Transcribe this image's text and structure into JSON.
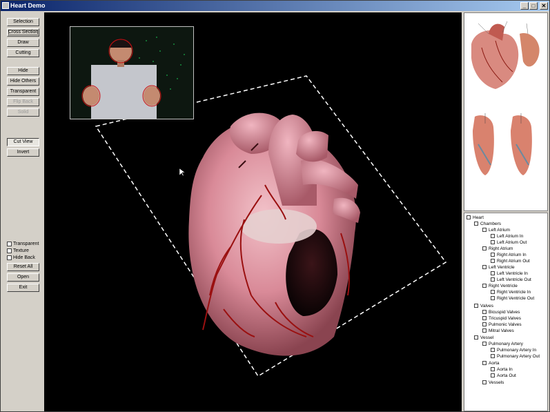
{
  "window": {
    "title": "Heart Demo"
  },
  "title_buttons": {
    "minimize": "_",
    "maximize": "□",
    "close": "✕"
  },
  "left_buttons": [
    "Selection",
    "Cross Section",
    "Draw",
    "Cutting",
    "Hide",
    "Hide Others",
    "Transparent",
    "Flip Back",
    "Solid"
  ],
  "view_buttons": [
    "Cut View",
    "Invert"
  ],
  "checkboxes": [
    "Transparent",
    "Texture",
    "Hide Back"
  ],
  "bottom_buttons": [
    "Reset All",
    "Open",
    "Exit"
  ],
  "tree": [
    "Heart",
    "Chambers",
    "Left Atrium",
    "Left Atrium In",
    "Left Atrium Out",
    "Right Atrium",
    "Right Atrium In",
    "Right Atrium Out",
    "Left Ventricle",
    "Left Ventricle In",
    "Left Ventricle Out",
    "Right Ventricle",
    "Right Ventricle In",
    "Right Ventricle Out",
    "Valves",
    "Bicuspid Valves",
    "Tricuspid Valves",
    "Pulmonic Valves",
    "Mitral Valves",
    "Vessel",
    "Pulmonary Artery",
    "Pulmonary Artery In",
    "Pulmonary Artery Out",
    "Aorta",
    "Aorta In",
    "Aorta Out",
    "Vessels"
  ],
  "colors": {
    "titlebar_start": "#0a246a",
    "titlebar_end": "#a6caf0",
    "viewport_bg": "#000000",
    "heart_pink": "#d98a98",
    "vessel_red": "#9a1010"
  }
}
